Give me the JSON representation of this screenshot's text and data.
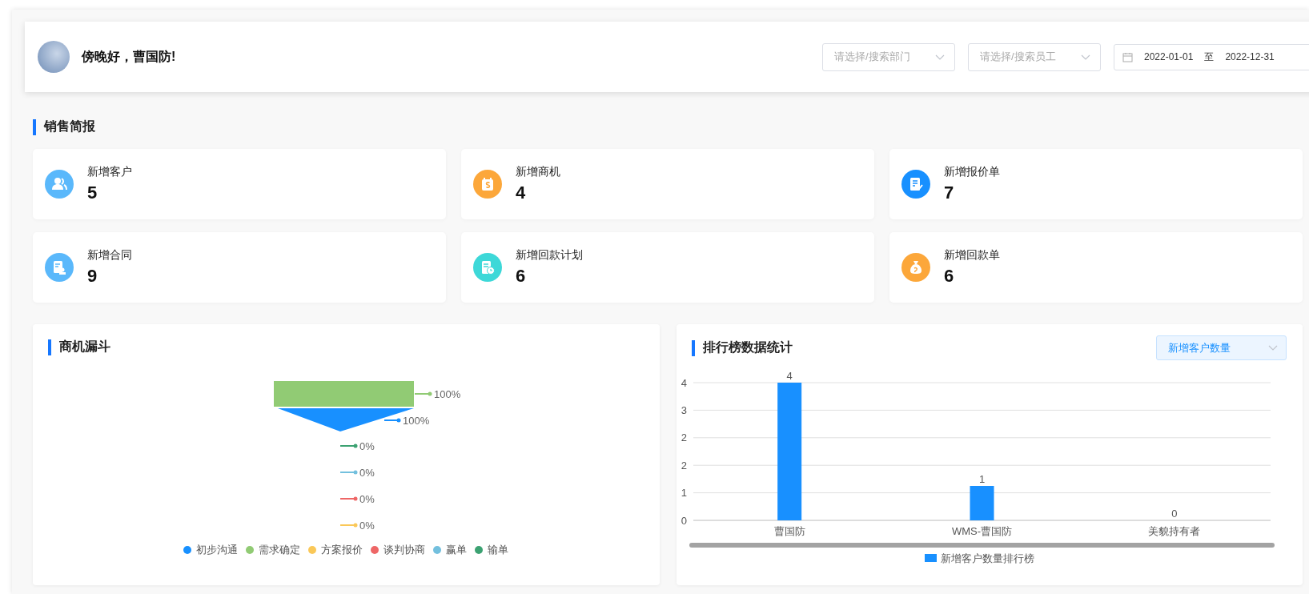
{
  "header": {
    "greeting": "傍晚好，曹国防!",
    "department_select": {
      "placeholder": "请选择/搜索部门"
    },
    "employee_select": {
      "placeholder": "请选择/搜索员工"
    },
    "date_range": {
      "start": "2022-01-01",
      "separator": "至",
      "end": "2022-12-31"
    }
  },
  "sales_summary": {
    "title": "销售简报",
    "cards": [
      {
        "label": "新增客户",
        "value": "5",
        "color": "#5ab8fb"
      },
      {
        "label": "新增商机",
        "value": "4",
        "color": "#fca73a"
      },
      {
        "label": "新增报价单",
        "value": "7",
        "color": "#1890ff"
      },
      {
        "label": "新增合同",
        "value": "9",
        "color": "#5ab8fb"
      },
      {
        "label": "新增回款计划",
        "value": "6",
        "color": "#3dd8d8"
      },
      {
        "label": "新增回款单",
        "value": "6",
        "color": "#fca73a"
      }
    ]
  },
  "funnel_panel": {
    "title": "商机漏斗",
    "stages": [
      {
        "kind": "rect",
        "color": "#91cb74",
        "label": "100%"
      },
      {
        "kind": "triangle",
        "color": "#1890ff",
        "label": "100%"
      },
      {
        "kind": "empty",
        "color": "#3ca272",
        "label": "0%"
      },
      {
        "kind": "empty",
        "color": "#73c0de",
        "label": "0%"
      },
      {
        "kind": "empty",
        "color": "#ee6666",
        "label": "0%"
      },
      {
        "kind": "empty",
        "color": "#fac858",
        "label": "0%"
      }
    ],
    "legend": [
      {
        "name": "初步沟通",
        "color": "#1890ff"
      },
      {
        "name": "需求确定",
        "color": "#91cb74"
      },
      {
        "name": "方案报价",
        "color": "#fac858"
      },
      {
        "name": "谈判协商",
        "color": "#ee6666"
      },
      {
        "name": "赢单",
        "color": "#73c0de"
      },
      {
        "name": "输单",
        "color": "#3ca272"
      }
    ]
  },
  "ranking_panel": {
    "title": "排行榜数据统计",
    "metric_select": {
      "value": "新增客户数量"
    },
    "chart_data": {
      "type": "bar",
      "categories": [
        "曹国防",
        "WMS-曹国防",
        "美貌持有者"
      ],
      "series": [
        {
          "name": "新增客户数量排行榜",
          "color": "#1890ff",
          "values": [
            4,
            1,
            0
          ]
        }
      ],
      "ylim": [
        0,
        4
      ],
      "yticks": [
        {
          "value": 0,
          "label": "0"
        },
        {
          "value": 0.8,
          "label": "1"
        },
        {
          "value": 1.6,
          "label": "2"
        },
        {
          "value": 2.4,
          "label": "2"
        },
        {
          "value": 3.2,
          "label": "3"
        },
        {
          "value": 4,
          "label": "4"
        }
      ],
      "data_labels": true,
      "grid": true
    }
  }
}
